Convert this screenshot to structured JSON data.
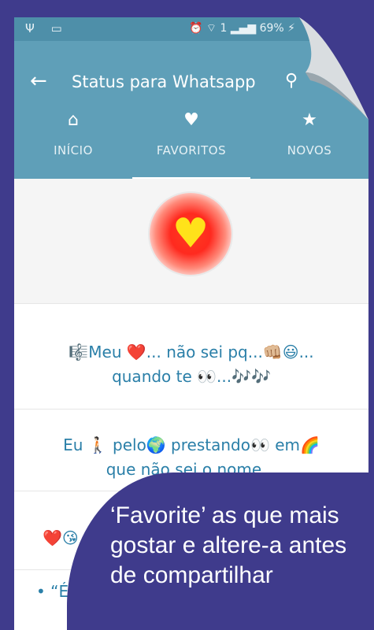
{
  "statusbar": {
    "left_icons": "Ψ ▭",
    "right_icons": "⏰ ⌔ 1 ▂▄▆ 69% ⚡"
  },
  "appbar": {
    "back_icon": "←",
    "title": "Status para Whatsapp",
    "search_icon": "⚲",
    "accent": "#5f9fb8"
  },
  "tabs": [
    {
      "icon": "⌂",
      "label": "INÍCIO"
    },
    {
      "icon": "♥",
      "label": "FAVORITOS"
    },
    {
      "icon": "★",
      "label": "NOVOS"
    }
  ],
  "hero": {
    "heart_icon": "♥"
  },
  "posts": [
    {
      "line1": "🎼Meu ❤️... não sei pq...👊🏼😃...",
      "line2": "quando te 👀...🎶🎶"
    },
    {
      "line1": "Eu 🚶🏻 pelo🌍 prestando👀 em🌈",
      "line2": "que não sei  o nome..."
    },
    {
      "line1": "❤️😘",
      "line2": ""
    },
    {
      "line1": "• “É",
      "line2": ""
    }
  ],
  "promo": {
    "text": "‘Favorite’ as que mais gostar e altere-a antes de compartilhar"
  }
}
